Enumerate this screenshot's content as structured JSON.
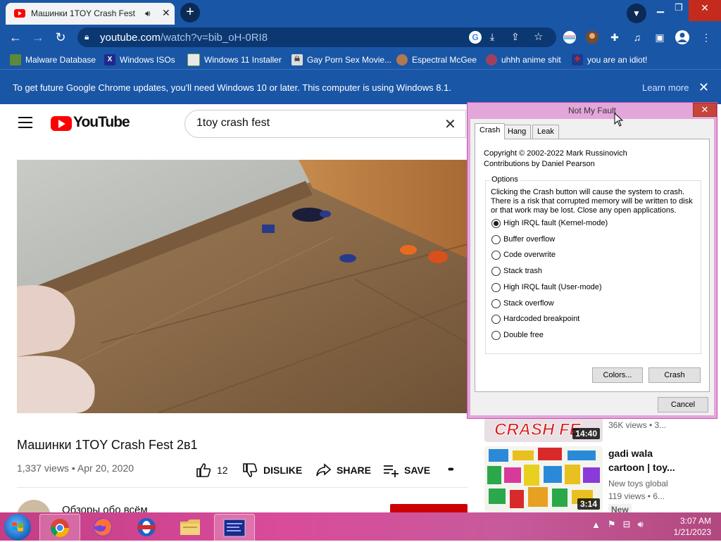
{
  "browser": {
    "tab_title": "Машинки 1TOY Crash Fest 2в1",
    "new_tab": "+",
    "url_host": "youtube.com",
    "url_path": "/watch?v=bib_oH-0RI8",
    "bookmarks": [
      {
        "label": "Malware Database",
        "icon": "green-figure-icon",
        "color": "#5a8a3a"
      },
      {
        "label": "Windows ISOs",
        "icon": "x-logo-icon",
        "color": "#1e2a8a"
      },
      {
        "label": "Windows 11 Installer",
        "icon": "picture-icon",
        "color": "#5fa04a"
      },
      {
        "label": "Gay Porn Sex Movie...",
        "icon": "skull-icon",
        "color": "#777777"
      },
      {
        "label": "Espectral McGee",
        "icon": "avatar-icon",
        "color": "#b07a50"
      },
      {
        "label": "uhhh anime shit",
        "icon": "anime-icon",
        "color": "#a04060"
      },
      {
        "label": "you are an idiot!",
        "icon": "flag-uk-icon",
        "color": "#c82828"
      }
    ],
    "infobar_message": "To get future Google Chrome updates, you'll need Windows 10 or later. This computer is using Windows 8.1.",
    "infobar_link": "Learn more"
  },
  "youtube": {
    "logo_text": "YouTube",
    "search_value": "1toy crash fest",
    "video_title": "Машинки 1TOY Crash Fest 2в1",
    "views": "1,337 views",
    "date": "Apr 20, 2020",
    "meta_separator": "•",
    "likes": "12",
    "dislike_label": "DISLIKE",
    "share_label": "SHARE",
    "save_label": "SAVE",
    "more_label": "•••",
    "channel_name": "Обзоры обо всём",
    "sidebar": [
      {
        "duration": "14:40",
        "meta": "36K views • 3...",
        "thumb_text": "CRASH FE"
      },
      {
        "duration": "3:14",
        "title_line1": "gadi wala",
        "title_line2": "cartoon | toy...",
        "channel": "New toys global",
        "meta": "119 views • 6...",
        "badge": "New"
      }
    ]
  },
  "dialog": {
    "title": "Not My Fault",
    "close": "✕",
    "tabs": [
      "Crash",
      "Hang",
      "Leak"
    ],
    "copyright": "Copyright © 2002-2022 Mark Russinovich",
    "contributions": "Contributions by Daniel Pearson",
    "options_label": "Options",
    "description": "Clicking the Crash button will cause the system to crash. There is a risk that corrupted memory will be written to disk or that work may be lost. Close any open applications.",
    "options": [
      {
        "label": "High IRQL fault (Kernel-mode)",
        "selected": true
      },
      {
        "label": "Buffer overflow",
        "selected": false
      },
      {
        "label": "Code overwrite",
        "selected": false
      },
      {
        "label": "Stack trash",
        "selected": false
      },
      {
        "label": "High IRQL fault (User-mode)",
        "selected": false
      },
      {
        "label": "Stack overflow",
        "selected": false
      },
      {
        "label": "Hardcoded breakpoint",
        "selected": false
      },
      {
        "label": "Double free",
        "selected": false
      }
    ],
    "colors_button": "Colors...",
    "crash_button": "Crash",
    "cancel_button": "Cancel"
  },
  "taskbar": {
    "time": "3:07 AM",
    "date": "1/21/2023",
    "apps": [
      "file-explorer-icon",
      "chrome-icon",
      "firefox-icon",
      "opera-icon",
      "folder-icon",
      "notmyfault-icon"
    ]
  },
  "colors": {
    "chrome_frame": "#1a56a6",
    "dialog_frame": "#e4a6da",
    "youtube_red": "#ff0000",
    "taskbar": "#d94c9a"
  }
}
